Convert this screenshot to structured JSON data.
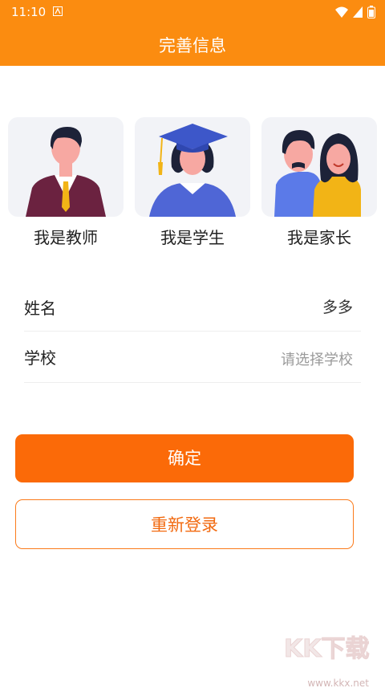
{
  "statusbar": {
    "time": "11:10"
  },
  "header": {
    "title": "完善信息"
  },
  "roles": [
    {
      "label": "我是教师"
    },
    {
      "label": "我是学生"
    },
    {
      "label": "我是家长"
    }
  ],
  "form": {
    "name_label": "姓名",
    "name_value": "多多",
    "school_label": "学校",
    "school_placeholder": "请选择学校"
  },
  "buttons": {
    "confirm": "确定",
    "relogin": "重新登录"
  },
  "watermark": {
    "text": "KK下载",
    "url": "www.kkx.net"
  },
  "colors": {
    "primary": "#fb6a08",
    "header": "#fb8c10"
  }
}
